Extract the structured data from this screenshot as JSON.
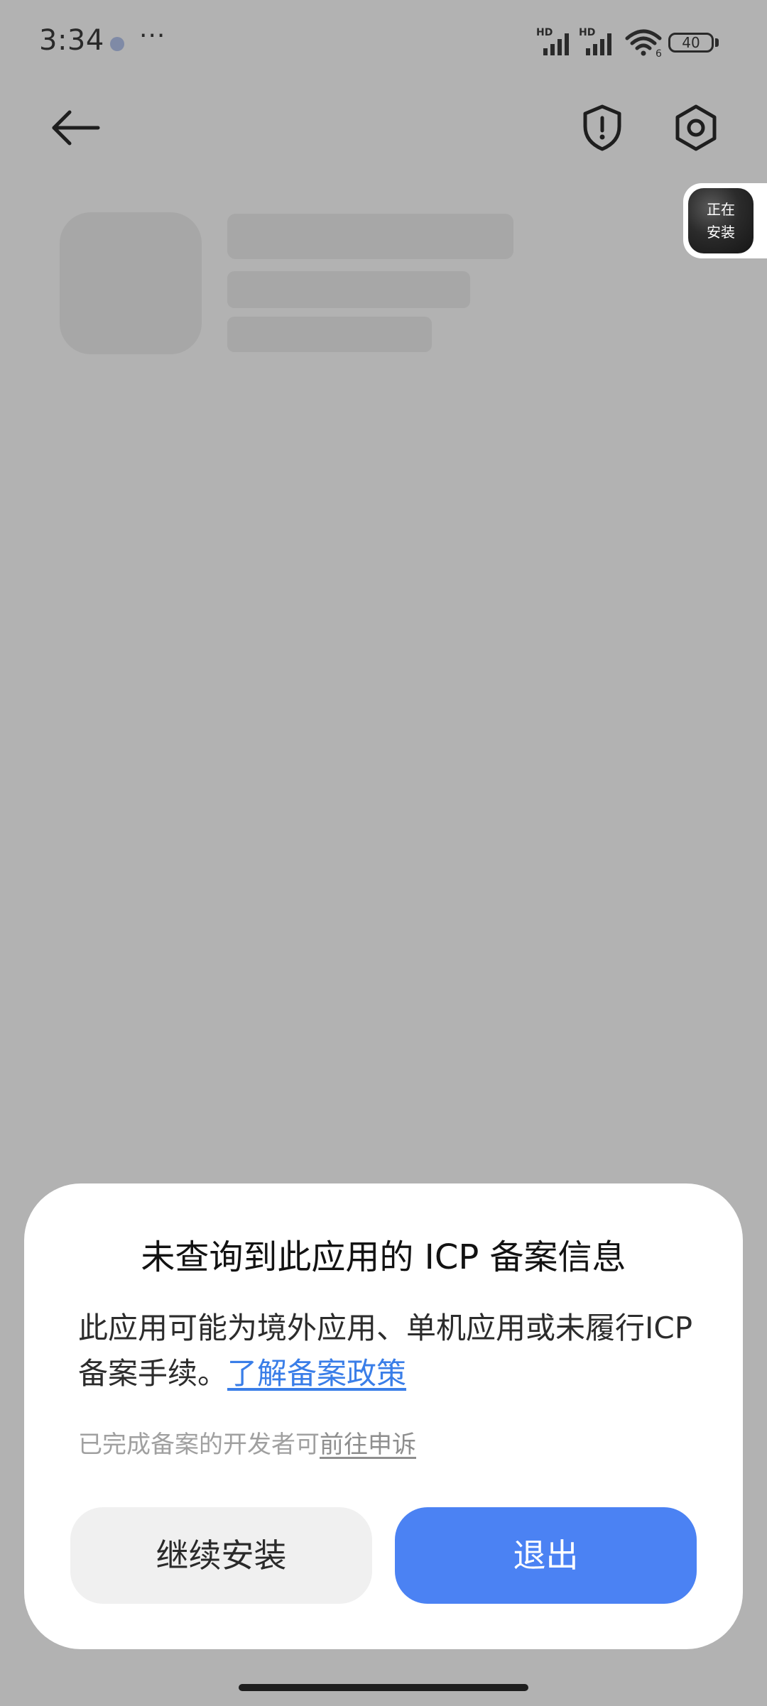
{
  "status_bar": {
    "time": "3:34",
    "more_indicator": "···",
    "signal_1_label": "HD",
    "signal_2_label": "HD",
    "wifi_label": "6",
    "battery_level": "40"
  },
  "app_bar": {
    "back_icon": "arrow-left-icon",
    "security_icon": "shield-exclamation-icon",
    "settings_icon": "hexagon-gear-icon"
  },
  "install_bubble": {
    "label": "正在\n安装"
  },
  "dialog": {
    "title": "未查询到此应用的 ICP 备案信息",
    "message": "此应用可能为境外应用、单机应用或未履行ICP 备案手续。",
    "policy_link": "了解备案政策",
    "hint": "已完成备案的开发者可",
    "appeal_link": "前往申诉",
    "continue_button": "继续安装",
    "exit_button": "退出"
  },
  "colors": {
    "scrim_background": "#b2b2b2",
    "dialog_background": "#ffffff",
    "primary_button": "#4b82f3",
    "secondary_button": "#f0f0f0",
    "link": "#3a7ee8"
  }
}
